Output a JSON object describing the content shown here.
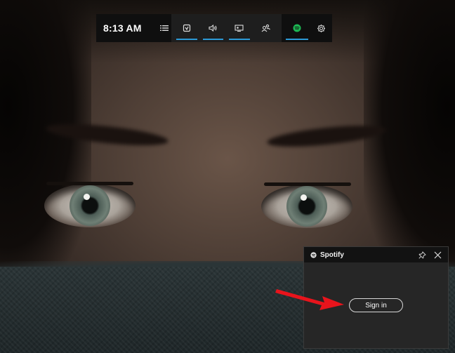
{
  "gamebar": {
    "time": "8:13 AM",
    "accent_color": "#2c9ad6",
    "buttons": [
      {
        "icon": "performance-icon",
        "active": true
      },
      {
        "icon": "audio-icon",
        "active": true
      },
      {
        "icon": "capture-icon",
        "active": true
      },
      {
        "icon": "xbox-social-icon",
        "active": false
      },
      {
        "icon": "spotify-icon",
        "active": true
      }
    ]
  },
  "spotify_widget": {
    "title": "Spotify",
    "sign_in_label": "Sign in",
    "brand_color": "#1db954"
  },
  "annotation": {
    "arrow_color": "#e8141c"
  }
}
